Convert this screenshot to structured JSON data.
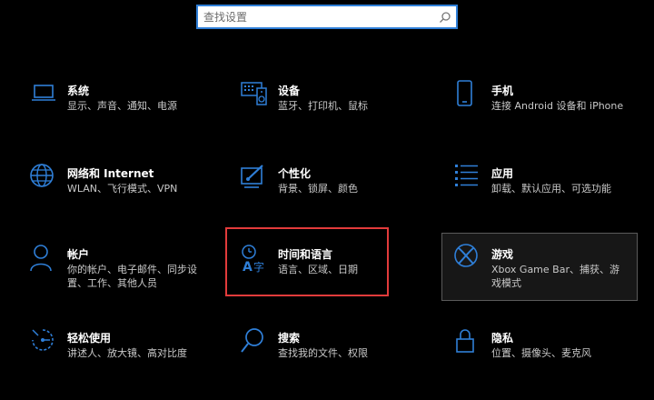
{
  "search": {
    "placeholder": "查找设置"
  },
  "tiles": [
    {
      "title": "系统",
      "desc": "显示、声音、通知、电源"
    },
    {
      "title": "设备",
      "desc": "蓝牙、打印机、鼠标"
    },
    {
      "title": "手机",
      "desc": "连接 Android 设备和 iPhone"
    },
    {
      "title": "网络和 Internet",
      "desc": "WLAN、飞行模式、VPN"
    },
    {
      "title": "个性化",
      "desc": "背景、锁屏、颜色"
    },
    {
      "title": "应用",
      "desc": "卸载、默认应用、可选功能"
    },
    {
      "title": "帐户",
      "desc": "你的帐户、电子邮件、同步设置、工作、其他人员"
    },
    {
      "title": "时间和语言",
      "desc": "语言、区域、日期"
    },
    {
      "title": "游戏",
      "desc": "Xbox Game Bar、捕获、游戏模式"
    },
    {
      "title": "轻松使用",
      "desc": "讲述人、放大镜、高对比度"
    },
    {
      "title": "搜索",
      "desc": "查找我的文件、权限"
    },
    {
      "title": "隐私",
      "desc": "位置、摄像头、麦克风"
    }
  ],
  "colors": {
    "accent": "#2f7fd8",
    "highlight_box": "#e23b3b"
  }
}
